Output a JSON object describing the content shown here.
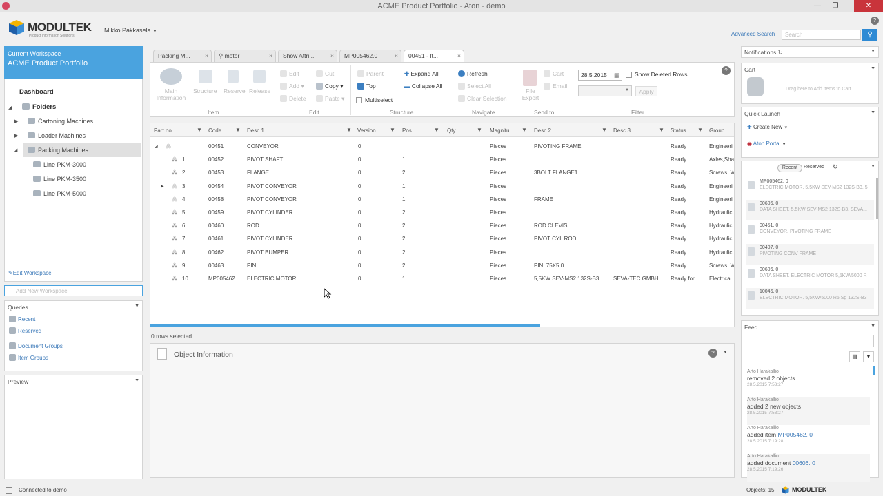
{
  "window": {
    "title": "ACME Product Portfolio - Aton - demo"
  },
  "header": {
    "logo": "MODULTEK",
    "logo_sub": "Product Information Solutions",
    "user": "Mikko Pakkasela",
    "advanced_search": "Advanced Search",
    "search_placeholder": "Search"
  },
  "workspace": {
    "label": "Current Workspace",
    "name": "ACME Product Portfolio",
    "edit": "Edit Workspace",
    "add_placeholder": "Add New Workspace"
  },
  "nav": {
    "dashboard": "Dashboard",
    "folders": "Folders",
    "items": [
      "Cartoning Machines",
      "Loader Machines",
      "Packing Machines"
    ],
    "sub": [
      "Line PKM-3000",
      "Line PKM-3500",
      "Line PKM-5000"
    ]
  },
  "queries": {
    "title": "Queries",
    "items": [
      "Recent",
      "Reserved",
      "Document Groups",
      "Item Groups"
    ]
  },
  "preview": {
    "title": "Preview"
  },
  "tabs": [
    "Packing M...",
    "motor",
    "Show Attri...",
    "MP005462.0",
    "00451 - It..."
  ],
  "ribbon": {
    "main_info": "Main Information",
    "structure": "Structure",
    "reserve": "Reserve",
    "release": "Release",
    "edit": "Edit",
    "add": "Add",
    "delete": "Delete",
    "cut": "Cut",
    "copy": "Copy",
    "paste": "Paste",
    "parent": "Parent",
    "top": "Top",
    "multiselect": "Multiselect",
    "expand_all": "Expand All",
    "collapse_all": "Collapse All",
    "refresh": "Refresh",
    "select_all": "Select All",
    "clear_selection": "Clear Selection",
    "file_export": "File Export",
    "cart": "Cart",
    "email": "Email",
    "date": "28.5.2015",
    "show_deleted": "Show Deleted Rows",
    "apply": "Apply",
    "groups": {
      "item": "Item",
      "edit": "Edit",
      "structure": "Structure",
      "navigate": "Navigate",
      "send_to": "Send to",
      "filter": "Filter"
    }
  },
  "grid": {
    "columns": [
      "Part no",
      "Code",
      "Desc 1",
      "Version",
      "Pos",
      "Qty",
      "Magnitu",
      "Desc 2",
      "Desc 3",
      "Status",
      "Group"
    ],
    "rows": [
      {
        "part": "",
        "code": "00451",
        "desc1": "CONVEYOR",
        "ver": "0",
        "pos": "",
        "qty": "",
        "mag": "Pieces",
        "desc2": "PIVOTING FRAME",
        "desc3": "",
        "status": "Ready",
        "group": "Engineeri"
      },
      {
        "part": "1",
        "code": "00452",
        "desc1": "PIVOT SHAFT",
        "ver": "0",
        "pos": "1",
        "qty": "",
        "mag": "Pieces",
        "desc2": "",
        "desc3": "",
        "status": "Ready",
        "group": "Axles,Sha"
      },
      {
        "part": "2",
        "code": "00453",
        "desc1": "FLANGE",
        "ver": "0",
        "pos": "2",
        "qty": "",
        "mag": "Pieces",
        "desc2": "3BOLT FLANGE1",
        "desc3": "",
        "status": "Ready",
        "group": "Screws, W"
      },
      {
        "part": "3",
        "code": "00454",
        "desc1": "PIVOT CONVEYOR",
        "ver": "0",
        "pos": "1",
        "qty": "",
        "mag": "Pieces",
        "desc2": "",
        "desc3": "",
        "status": "Ready",
        "group": "Engineeri"
      },
      {
        "part": "4",
        "code": "00458",
        "desc1": "PIVOT CONVEYOR",
        "ver": "0",
        "pos": "1",
        "qty": "",
        "mag": "Pieces",
        "desc2": "FRAME",
        "desc3": "",
        "status": "Ready",
        "group": "Engineeri"
      },
      {
        "part": "5",
        "code": "00459",
        "desc1": "PIVOT CYLINDER",
        "ver": "0",
        "pos": "2",
        "qty": "",
        "mag": "Pieces",
        "desc2": "",
        "desc3": "",
        "status": "Ready",
        "group": "Hydraulic"
      },
      {
        "part": "6",
        "code": "00460",
        "desc1": "ROD",
        "ver": "0",
        "pos": "2",
        "qty": "",
        "mag": "Pieces",
        "desc2": "ROD CLEVIS",
        "desc3": "",
        "status": "Ready",
        "group": "Hydraulic"
      },
      {
        "part": "7",
        "code": "00461",
        "desc1": "PIVOT CYLINDER",
        "ver": "0",
        "pos": "2",
        "qty": "",
        "mag": "Pieces",
        "desc2": "PIVOT CYL ROD",
        "desc3": "",
        "status": "Ready",
        "group": "Hydraulic"
      },
      {
        "part": "8",
        "code": "00462",
        "desc1": "PIVOT BUMPER",
        "ver": "0",
        "pos": "2",
        "qty": "",
        "mag": "Pieces",
        "desc2": "",
        "desc3": "",
        "status": "Ready",
        "group": "Hydraulic"
      },
      {
        "part": "9",
        "code": "00463",
        "desc1": "PIN",
        "ver": "0",
        "pos": "2",
        "qty": "",
        "mag": "Pieces",
        "desc2": "PIN .75X5.0",
        "desc3": "",
        "status": "Ready",
        "group": "Screws, W"
      },
      {
        "part": "10",
        "code": "MP005462",
        "desc1": "ELECTRIC MOTOR",
        "ver": "0",
        "pos": "1",
        "qty": "",
        "mag": "Pieces",
        "desc2": "5,5KW SEV-MS2 132S-B3",
        "desc3": "SEVA-TEC GMBH",
        "status": "Ready for...",
        "group": "Electrical"
      }
    ],
    "rows_selected": "0 rows selected"
  },
  "object_info": {
    "title": "Object Information"
  },
  "right": {
    "notifications": "Notifications",
    "cart": "Cart",
    "cart_hint": "Drag here to Add items to Cart",
    "quick_launch": "Quick Launch",
    "create_new": "Create New",
    "aton_portal": "Aton Portal",
    "recent_tab": "Recent",
    "reserved_tab": "Reserved",
    "recent": [
      {
        "t1": "MP005462. 0",
        "t2": "ELECTRIC MOTOR. 5,5KW SEV-MS2 132S-B3. 5"
      },
      {
        "t1": "00606. 0",
        "t2": "DATA SHEET. 5,5KW SEV-MS2 132S-B3. SEVA..."
      },
      {
        "t1": "00451. 0",
        "t2": "CONVEYOR. PIVOTING FRAME"
      },
      {
        "t1": "00407. 0",
        "t2": "PIVOTING CONV FRAME"
      },
      {
        "t1": "00606. 0",
        "t2": "DATA SHEET. ELECTRIC MOTOR 5,5KW/5000 R"
      },
      {
        "t1": "10046. 0",
        "t2": "ELECTRIC MOTOR. 5,5KW/5000 R5 Sg 132S-B3"
      }
    ],
    "feed": "Feed",
    "feed_items": [
      {
        "a": "Arto Harakallio",
        "b": "removed 2 objects",
        "link": "",
        "d": "28.5.2015 7:53:27"
      },
      {
        "a": "Arto Harakallio",
        "b": "added 2 new objects",
        "link": "",
        "d": "28.5.2015 7:53:27"
      },
      {
        "a": "Arto Harakallio",
        "b": "added item ",
        "link": "MP005462. 0",
        "d": "28.5.2015 7:19:28"
      },
      {
        "a": "Arto Harakallio",
        "b": "added document ",
        "link": "00606. 0",
        "d": "28.5.2015 7:19:26"
      }
    ]
  },
  "status": {
    "connected": "Connected to demo",
    "objects": "Objects: 15",
    "brand": "MODULTEK"
  }
}
